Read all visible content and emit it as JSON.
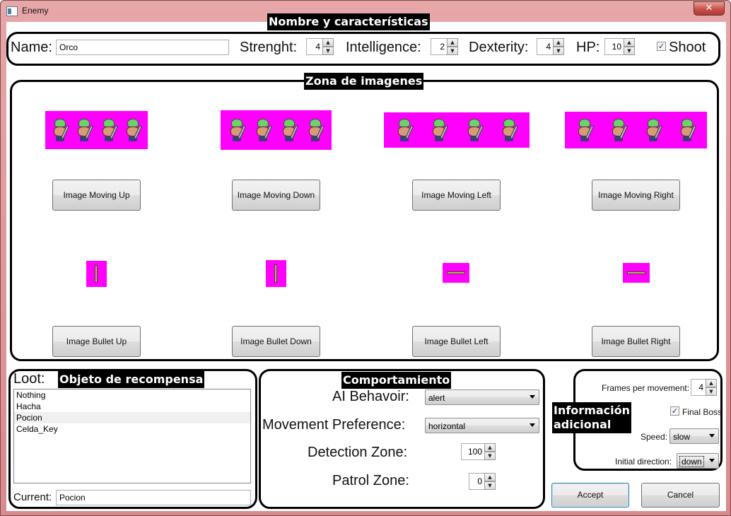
{
  "window": {
    "title": "Enemy",
    "close_glyph": "✕"
  },
  "sections": {
    "name_characteristics": "Nombre y características",
    "images": "Zona de imagenes",
    "loot": "Objeto de recompensa",
    "behavior": "Comportamiento",
    "additional": [
      "Información",
      "adicional"
    ]
  },
  "characteristics": {
    "name_label": "Name:",
    "name_value": "Orco",
    "strength_label": "Strenght:",
    "strength_value": "4",
    "intelligence_label": "Intelligence:",
    "intelligence_value": "2",
    "dexterity_label": "Dexterity:",
    "dexterity_value": "4",
    "hp_label": "HP:",
    "hp_value": "10",
    "shoot_label": "Shoot",
    "shoot_checked": "✓"
  },
  "image_buttons": {
    "moving_up": "Image Moving Up",
    "moving_down": "Image Moving Down",
    "moving_left": "Image Moving Left",
    "moving_right": "Image Moving Right",
    "bullet_up": "Image Bullet Up",
    "bullet_down": "Image Bullet Down",
    "bullet_left": "Image Bullet Left",
    "bullet_right": "Image Bullet Right"
  },
  "loot": {
    "label": "Loot:",
    "items": [
      "Nothing",
      "Hacha",
      "Pocion",
      "Celda_Key"
    ],
    "selected_index": 2,
    "current_label": "Current:",
    "current_value": "Pocion"
  },
  "behavior": {
    "ai_label": "AI Behavoir:",
    "ai_value": "alert",
    "movement_label": "Movement Preference:",
    "movement_value": "horizontal",
    "detection_label": "Detection Zone:",
    "detection_value": "100",
    "patrol_label": "Patrol Zone:",
    "patrol_value": "0"
  },
  "additional": {
    "frames_label": "Frames per movement:",
    "frames_value": "4",
    "final_boss_label": "Final Boss",
    "final_boss_checked": "✓",
    "speed_label": "Speed:",
    "speed_value": "slow",
    "direction_label": "Initial direction:",
    "direction_value": "down"
  },
  "actions": {
    "accept": "Accept",
    "cancel": "Cancel"
  },
  "colors": {
    "sprite_background": "#ff00ff",
    "frame": "#d98a8d"
  },
  "arrows": {
    "up": "▲",
    "down": "▼"
  }
}
